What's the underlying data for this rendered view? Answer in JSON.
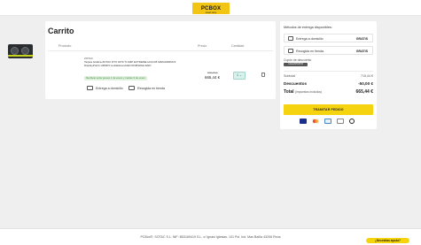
{
  "header": {
    "logo_text": "PCBOX",
    "logo_tagline": "smart store"
  },
  "cart": {
    "title": "Carrito",
    "columns": {
      "product": "Producto",
      "price": "Precio",
      "quantity": "Cantidad"
    },
    "items": [
      {
        "brand": "ZOTAC",
        "name": "Tarjeta Gráfica ZOTAC RTX 3070 TI AMP EXTREME HOLO/8 GB/GDDR6X/3 DisplayPort/1 HDMI/3 ventiladores/LED RGB/HIGH END",
        "stock_badge": "Recíbelo entre jueves 1 de enero y martes 3 de enero",
        "ship_home_label": "Entrega a domicilio",
        "ship_store_label": "Recogida en tienda",
        "old_price": "699,00 €",
        "price": "665,44 €",
        "quantity": "1 ⌄"
      }
    ]
  },
  "summary": {
    "title": "Métodos de entrega disponibles:",
    "options": [
      {
        "label": "Entrega a domicilio",
        "value": "GRATIS"
      },
      {
        "label": "Recogida en tienda",
        "value": "GRATIS"
      }
    ],
    "coupon_label": "Cupón de descuento",
    "coupon_chip": "CALENTAPC5",
    "subtotal_label": "Subtotal",
    "subtotal_value": "715,44 €",
    "discount_label": "Descuentos",
    "discount_value": "-50,00 €",
    "total_label": "Total",
    "total_note": "(Impuestos incluidos)",
    "total_value": "665,44 €",
    "pay_button": "TRAMITAR PEDIDO",
    "payment_icons": [
      "visa-icon",
      "mastercard-icon",
      "amex-icon",
      "paypal-icon",
      "bizum-icon"
    ]
  },
  "footer": {
    "text": "PCBox®, SOTAC S.L. NIF: B53169419 S.L. c/ Ignasi Iglesias, 101 Pol. Ind. Mas Baiña 43206 Reus",
    "help_button": "¿Necesitas ayuda?"
  },
  "colors": {
    "accent": "#f5d30f",
    "background": "#efefef",
    "badge_green": "#dff1de"
  }
}
